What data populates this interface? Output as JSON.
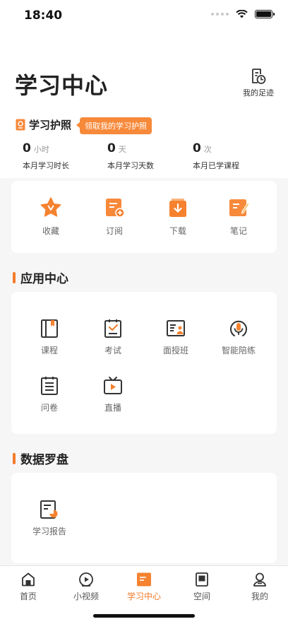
{
  "status": {
    "time": "18:40"
  },
  "header": {
    "title": "学习中心",
    "footprint_label": "我的足迹"
  },
  "passport": {
    "title": "学习护照",
    "tip": "领取我的学习护照",
    "stats": [
      {
        "value": "0",
        "unit": "小时",
        "label": "本月学习时长"
      },
      {
        "value": "0",
        "unit": "天",
        "label": "本月学习天数"
      },
      {
        "value": "0",
        "unit": "次",
        "label": "本月已学课程"
      }
    ]
  },
  "quick_actions": [
    {
      "label": "收藏",
      "icon": "favorite-icon"
    },
    {
      "label": "订阅",
      "icon": "subscribe-icon"
    },
    {
      "label": "下载",
      "icon": "download-icon"
    },
    {
      "label": "笔记",
      "icon": "notes-icon"
    }
  ],
  "app_center": {
    "title": "应用中心",
    "items": [
      {
        "label": "课程",
        "icon": "course-icon"
      },
      {
        "label": "考试",
        "icon": "exam-icon"
      },
      {
        "label": "面授班",
        "icon": "classroom-icon"
      },
      {
        "label": "智能陪练",
        "icon": "ai-practice-icon"
      },
      {
        "label": "问卷",
        "icon": "survey-icon"
      },
      {
        "label": "直播",
        "icon": "live-icon"
      }
    ]
  },
  "data_compass": {
    "title": "数据罗盘",
    "items": [
      {
        "label": "学习报告",
        "icon": "report-icon"
      }
    ]
  },
  "tabbar": {
    "active": "学习中心",
    "tabs": [
      {
        "label": "首页",
        "icon": "home-icon"
      },
      {
        "label": "小视频",
        "icon": "short-video-icon"
      },
      {
        "label": "学习中心",
        "icon": "learning-center-icon"
      },
      {
        "label": "空间",
        "icon": "space-icon"
      },
      {
        "label": "我的",
        "icon": "profile-icon"
      }
    ]
  },
  "colors": {
    "accent": "#f47b2a",
    "background": "#f6f6f7"
  }
}
